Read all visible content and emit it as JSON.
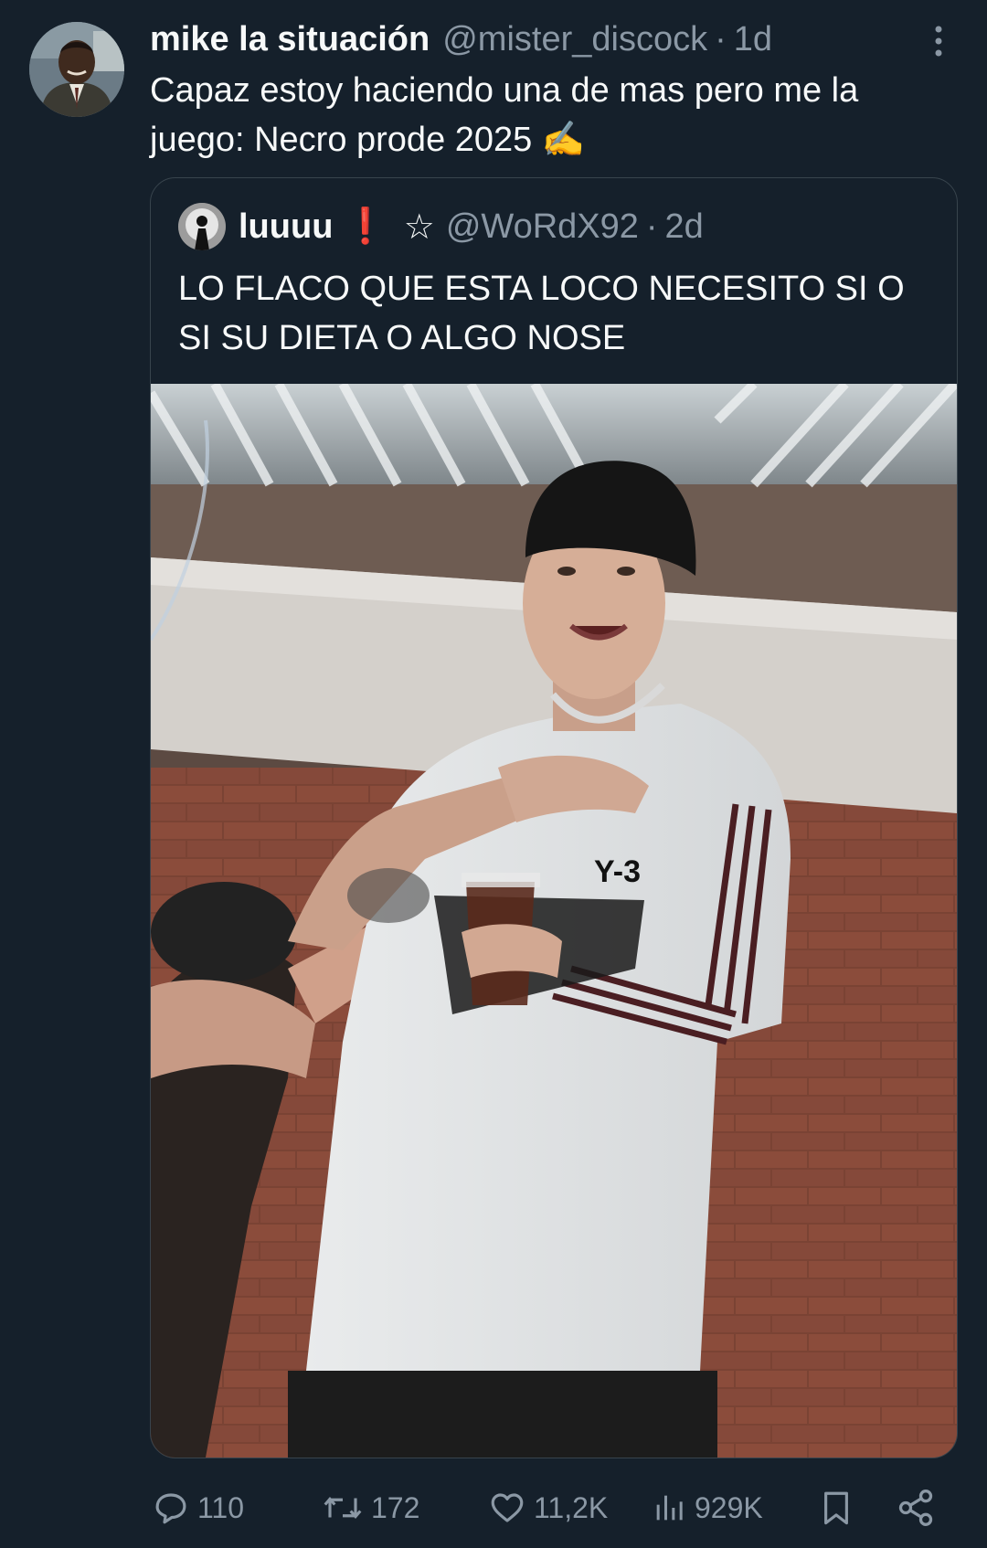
{
  "tweet": {
    "author_name": "mike la situación",
    "author_handle": "@mister_discock",
    "separator": "·",
    "time": "1d",
    "text": "Capaz estoy haciendo una de mas pero me la juego: Necro prode 2025 ✍️"
  },
  "quote": {
    "author_name": "luuuu",
    "exclaim": "❗",
    "star": "☆",
    "author_handle": "@WoRdX92",
    "separator": "·",
    "time": "2d",
    "text": "LO FLACO QUE ESTA LOCO NECESITO SI O SI SU DIETA O ALGO NOSE",
    "media_logo_text": "Y-3"
  },
  "actions": {
    "replies": "110",
    "reposts": "172",
    "likes": "11,2K",
    "views": "929K"
  },
  "colors": {
    "background": "#15202b",
    "text": "#f7f9f9",
    "secondary": "#8b98a5",
    "border": "#38444d"
  }
}
